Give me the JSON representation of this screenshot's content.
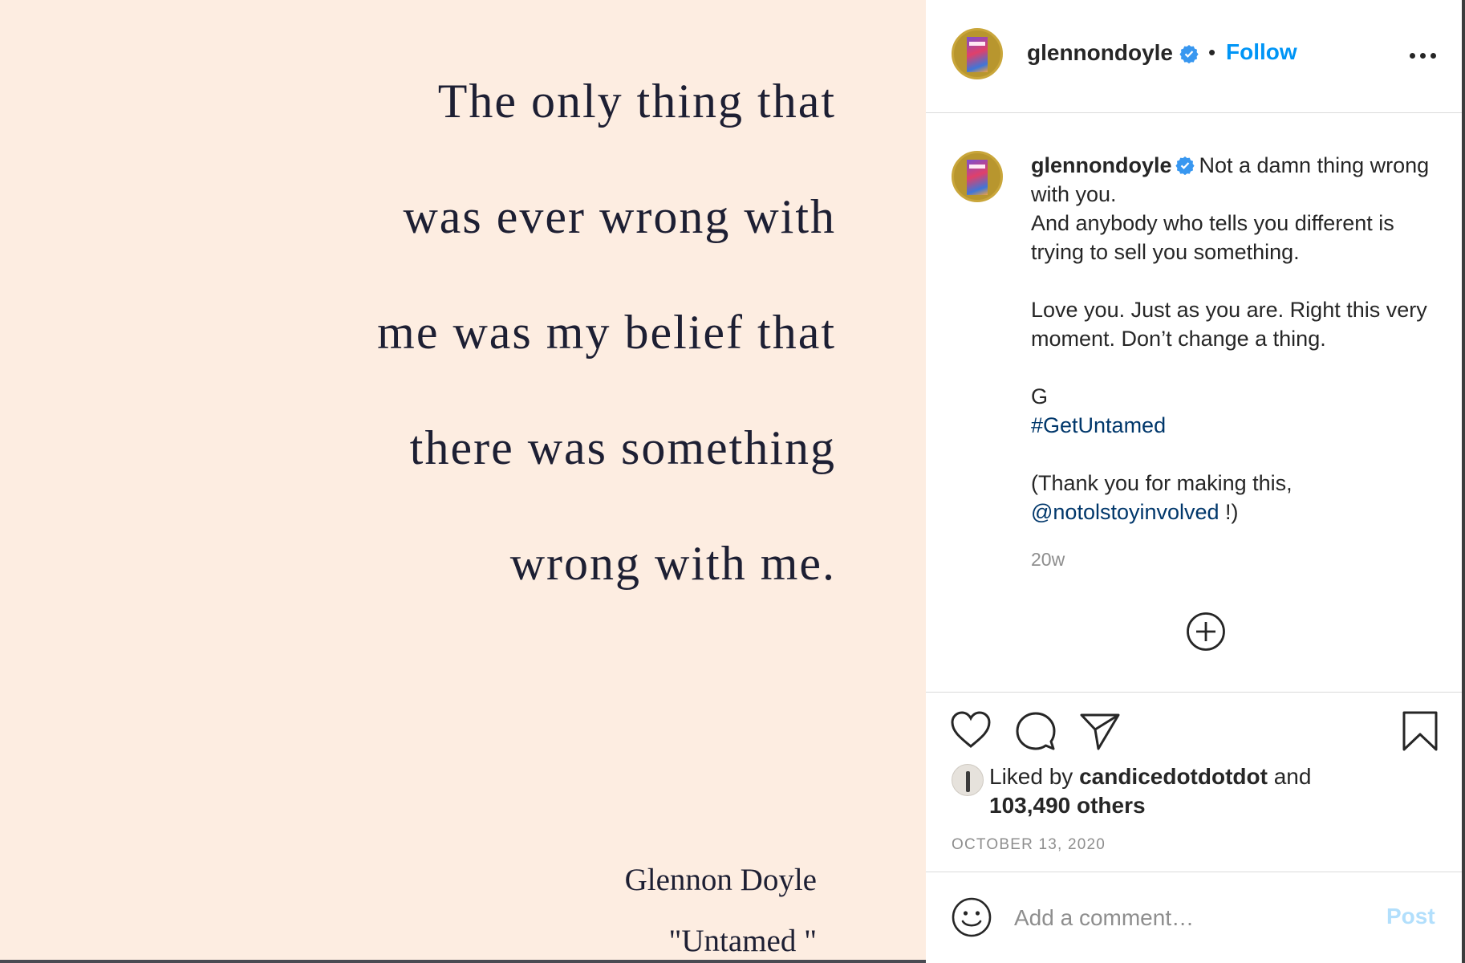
{
  "quote": {
    "lines": [
      "The only thing that",
      "was ever wrong with",
      "me was my belief that",
      "there was something",
      "wrong with me."
    ],
    "author": "Glennon Doyle",
    "book": "\"Untamed \""
  },
  "header": {
    "username": "glennondoyle",
    "separator": "•",
    "follow_label": "Follow",
    "more_icon": "more-options-icon",
    "verified_icon": "verified-badge-icon"
  },
  "caption": {
    "username": "glennondoyle",
    "line1": "Not a damn thing wrong with you.",
    "line2": "And anybody who tells you different is trying to sell you something.",
    "line3": "Love you. Just as you are. Right this very moment. Don’t change a thing.",
    "line4": "G",
    "hashtag": "#GetUntamed",
    "line5_prefix": "(Thank you for making this,",
    "mention": "@notolstoyinvolved",
    "line5_suffix": " !)",
    "time_ago": "20w"
  },
  "actions": {
    "icons": [
      "heart-icon",
      "comment-icon",
      "share-icon",
      "bookmark-icon",
      "load-more-icon"
    ]
  },
  "likes": {
    "prefix": "Liked by",
    "user": "candicedotdotdot",
    "and": "and",
    "others": "103,490 others"
  },
  "date": "OCTOBER 13, 2020",
  "comment": {
    "placeholder": "Add a comment…",
    "post_label": "Post"
  },
  "colors": {
    "follow": "#0095f6",
    "link": "#00376b",
    "post_disabled": "#b2dffc",
    "photo_bg": "#fdede1",
    "verified": "#3897f0"
  }
}
